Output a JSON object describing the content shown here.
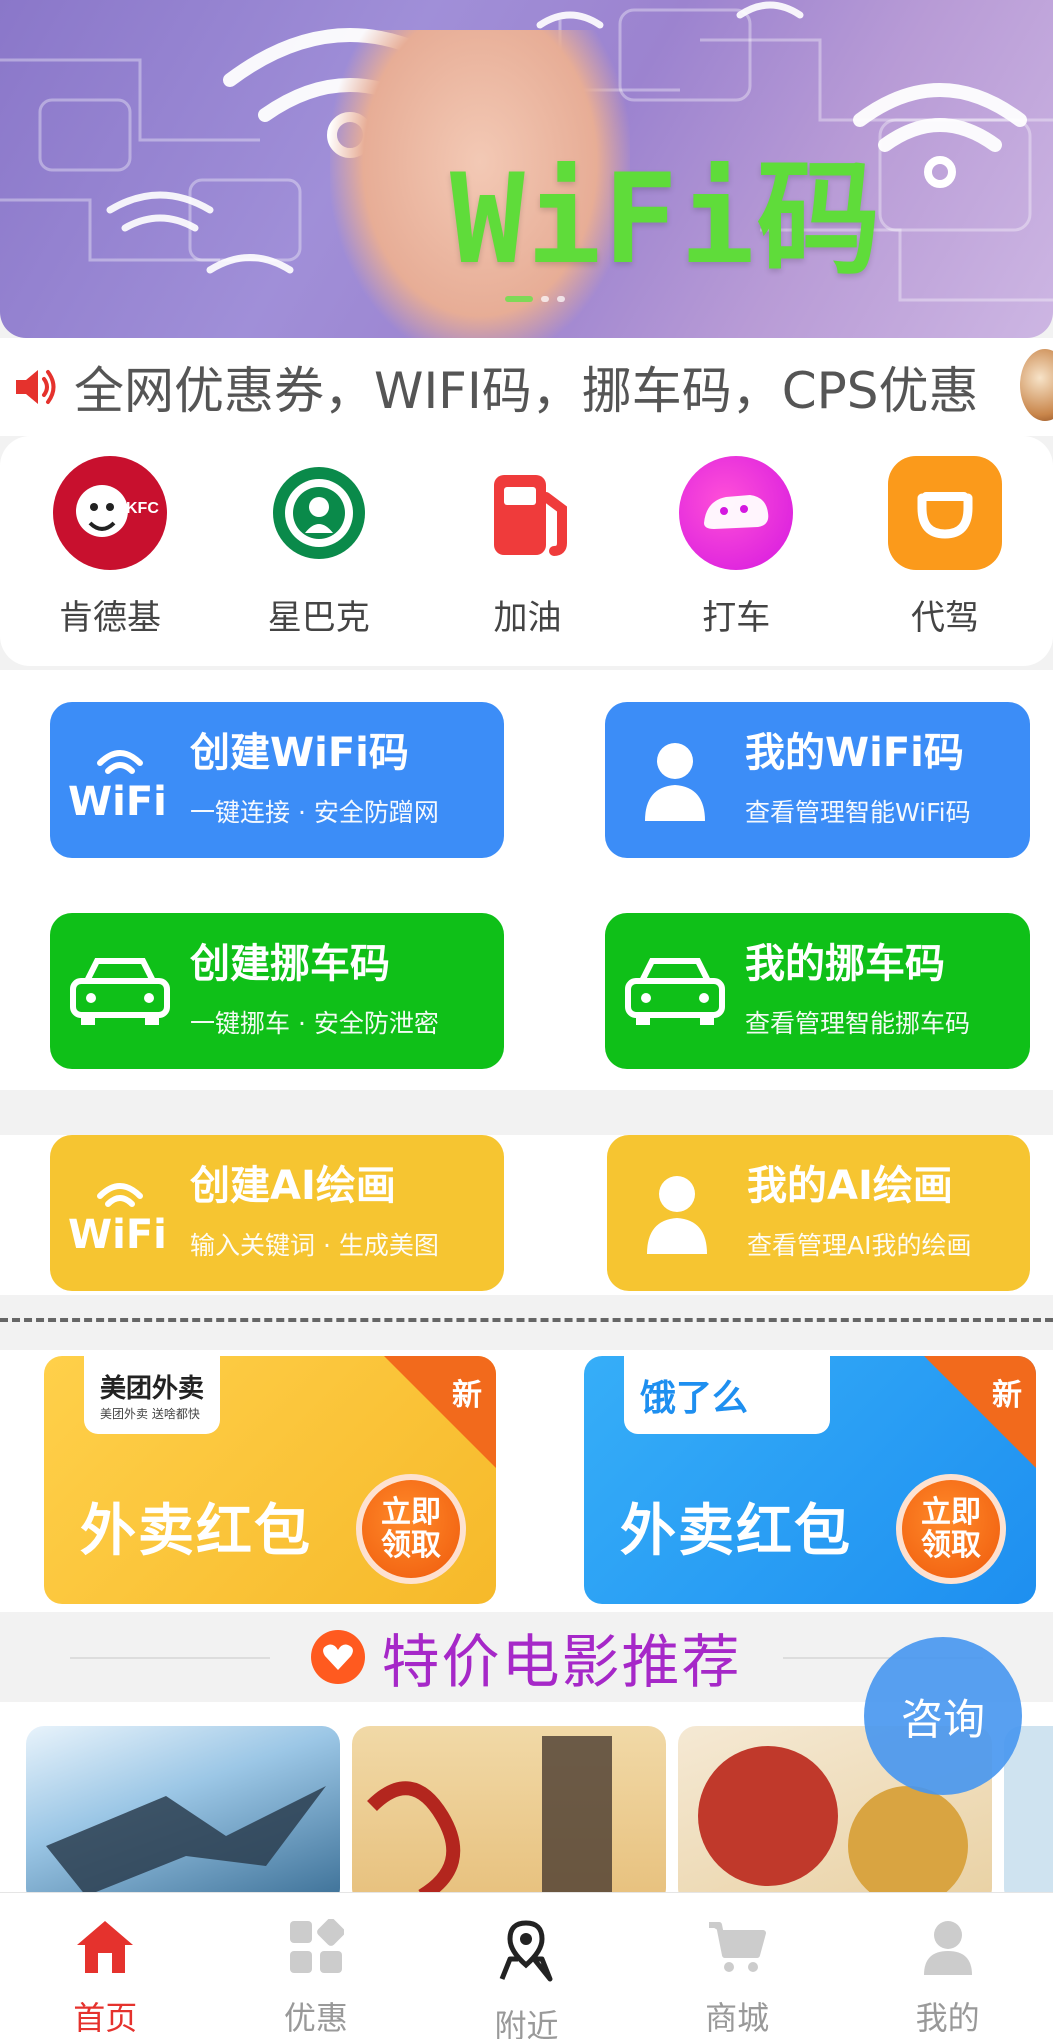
{
  "banner": {
    "text": "WiFi码"
  },
  "notice": {
    "text": "全网优惠券，WIFI码，挪车码，CPS优惠"
  },
  "shortcuts": [
    {
      "label": "肯德基",
      "icon": "kfc-icon"
    },
    {
      "label": "星巴克",
      "icon": "starbucks-icon"
    },
    {
      "label": "加油",
      "icon": "fuel-icon"
    },
    {
      "label": "打车",
      "icon": "taxi-icon"
    },
    {
      "label": "代驾",
      "icon": "designated-driver-icon"
    }
  ],
  "cards": {
    "create_wifi": {
      "title": "创建WiFi码",
      "sub": "一键连接 · 安全防蹭网",
      "icon_text": "WiFi"
    },
    "my_wifi": {
      "title": "我的WiFi码",
      "sub": "查看管理智能WiFi码"
    },
    "create_move": {
      "title": "创建挪车码",
      "sub": "一键挪车 · 安全防泄密"
    },
    "my_move": {
      "title": "我的挪车码",
      "sub": "查看管理智能挪车码"
    },
    "create_ai": {
      "title": "创建AI绘画",
      "sub": "输入关键词 · 生成美图",
      "icon_text": "WiFi"
    },
    "my_ai": {
      "title": "我的AI绘画",
      "sub": "查看管理AI我的绘画"
    }
  },
  "packets": [
    {
      "brand": "美团外卖",
      "brand_sub": "美团外卖 送啥都快",
      "big": "外卖红包",
      "badge": "新",
      "claim1": "立即",
      "claim2": "领取",
      "color": "#f8c538"
    },
    {
      "brand": "饿了么",
      "big": "外卖红包",
      "badge": "新",
      "claim1": "立即",
      "claim2": "领取",
      "color": "#2aa0f5"
    }
  ],
  "movies": {
    "title": "特价电影推荐"
  },
  "consult": {
    "label": "咨询"
  },
  "tabbar": [
    {
      "label": "首页",
      "active": true
    },
    {
      "label": "优惠"
    },
    {
      "label": "附近"
    },
    {
      "label": "商城"
    },
    {
      "label": "我的"
    }
  ],
  "colors": {
    "accent": "#e5322d",
    "blue": "#3c8df7",
    "green": "#0fc018",
    "yellow": "#f6c531"
  }
}
